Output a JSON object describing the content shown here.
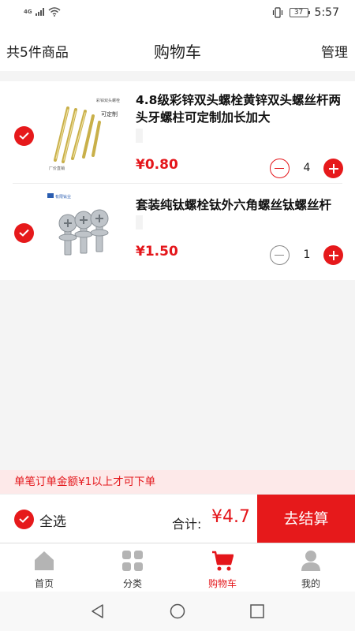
{
  "status_bar": {
    "network": "4G",
    "battery": "37",
    "time": "5:57"
  },
  "header": {
    "item_count": "共5件商品",
    "title": "购物车",
    "manage": "管理"
  },
  "items": [
    {
      "name": "4.8级彩锌双头螺栓黄锌双头螺丝杆两头牙螺柱可定制加长加大",
      "price": "¥0.80",
      "quantity": "4",
      "selected": true,
      "thumb_text": [
        "彩锌双头螺栓",
        "可定制",
        "厂价直销"
      ]
    },
    {
      "name": "套装纯钛螺栓钛外六角螺丝钛螺丝杆",
      "price": "¥1.50",
      "quantity": "1",
      "selected": true,
      "thumb_text": [
        "有限钛业"
      ]
    }
  ],
  "notice": "单笔订单金额¥1以上才可下单",
  "checkout": {
    "select_all": "全选",
    "total_label": "合计:",
    "total_value": "¥4.7",
    "button": "去结算"
  },
  "nav": [
    {
      "label": "首页",
      "icon": "home-icon"
    },
    {
      "label": "分类",
      "icon": "grid-icon"
    },
    {
      "label": "购物车",
      "icon": "cart-icon",
      "active": true
    },
    {
      "label": "我的",
      "icon": "user-icon"
    }
  ],
  "colors": {
    "accent": "#e6191b",
    "price": "#e4161b",
    "notice_bg": "#fde9e9"
  }
}
